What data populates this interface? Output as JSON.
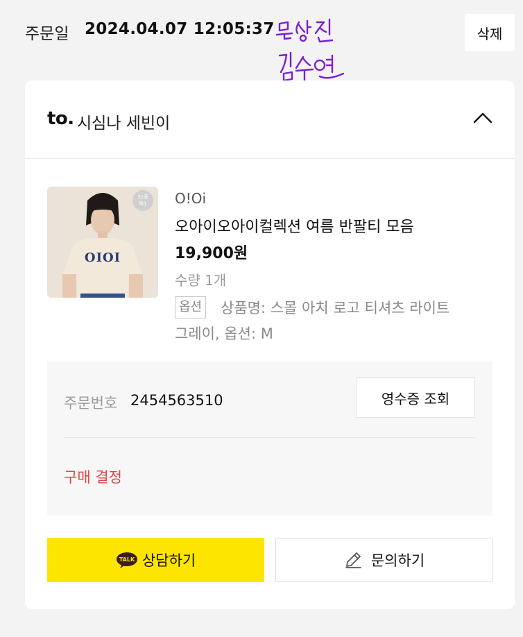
{
  "header": {
    "order_date_label": "주문일",
    "order_date_value": "2024.04.07 12:05:37",
    "delete_label": "삭제",
    "handwritten_note": [
      "문상진",
      "김수연"
    ]
  },
  "store": {
    "logo": "to.",
    "name": "시심나 세빈이",
    "collapse_icon": "chevron-up-icon"
  },
  "product": {
    "brand": "O!Oi",
    "name": "오아이오아이컬렉션 여름 반팔티 모음",
    "price": "19,900원",
    "quantity": "수량 1개",
    "option_tag": "옵션",
    "option_line1": "상품명: 스몰 아치 로고 티셔츠 라이트",
    "option_line2": "그레이, 옵션: M",
    "thumb_badge": [
      "31종",
      "택1"
    ],
    "shirt_print": "OIOI"
  },
  "order": {
    "number_label": "주문번호",
    "number_value": "2454563510",
    "receipt_label": "영수증 조회",
    "status": "구매 결정"
  },
  "actions": {
    "talk_label": "상담하기",
    "talk_icon_text": "TALK",
    "inquiry_label": "문의하기"
  },
  "colors": {
    "talk_yellow": "#fee500",
    "status_red": "#e04444",
    "handwriting_purple": "#7a1fd6"
  }
}
